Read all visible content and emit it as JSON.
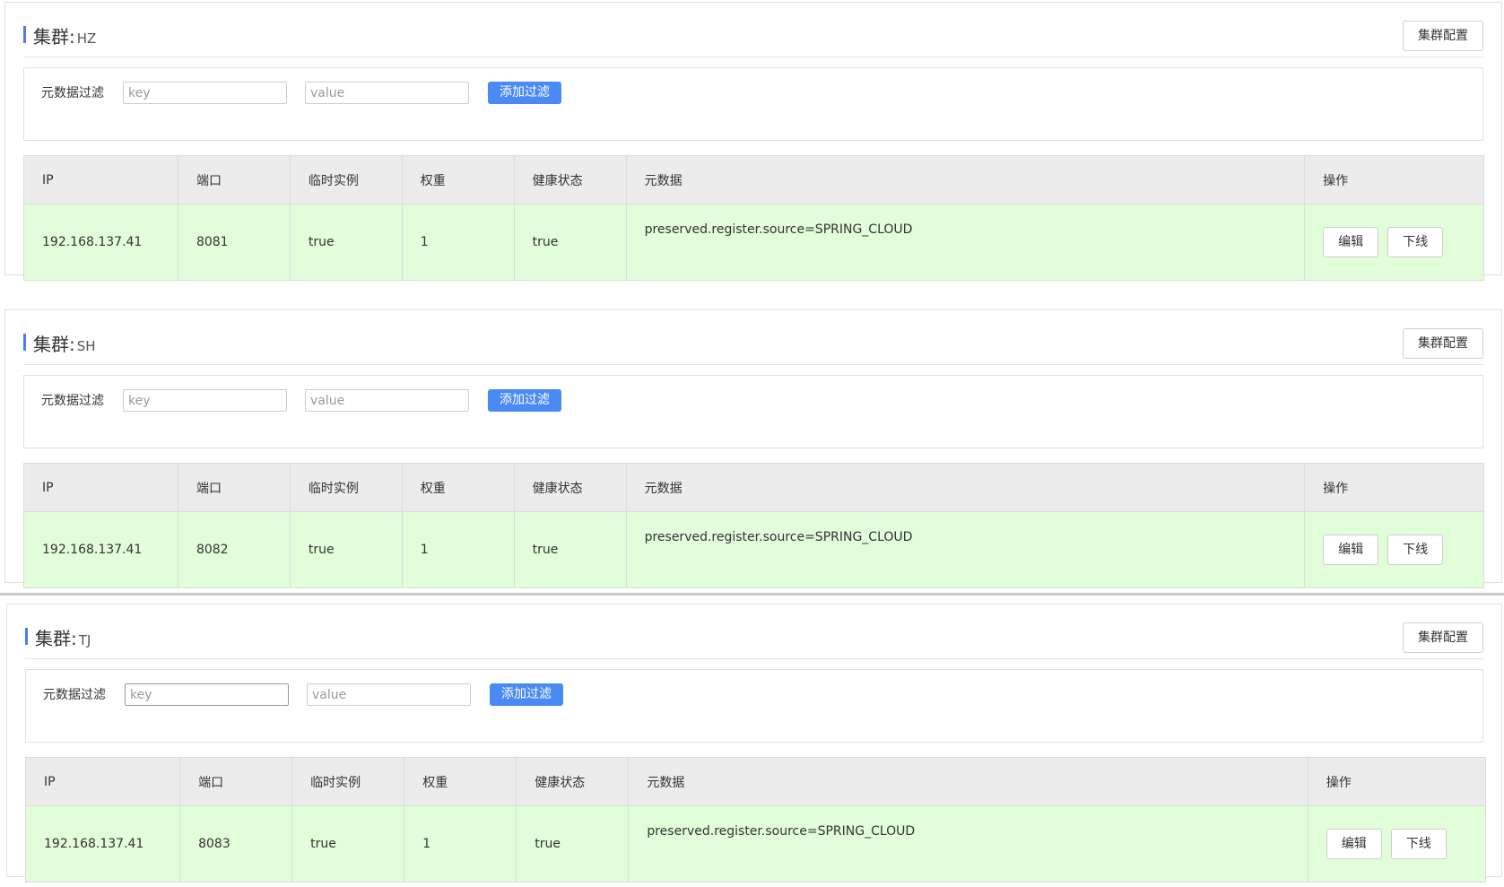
{
  "filter_label": "元数据过滤",
  "key_placeholder": "key",
  "value_placeholder": "value",
  "add_filter_label": "添加过滤",
  "cluster_title_prefix": "集群:",
  "cluster_config_label": "集群配置",
  "table_headers": [
    "IP",
    "端口",
    "临时实例",
    "权重",
    "健康状态",
    "元数据",
    "操作"
  ],
  "edit_label": "编辑",
  "offline_label": "下线",
  "colors": {
    "accent": "#4a7cf6",
    "add_filter_bg": "#4a8af4",
    "row_bg": "#e2fdd9",
    "header_bg": "#ececec"
  },
  "clusters": [
    {
      "name": "HZ",
      "instances": [
        {
          "ip": "192.168.137.41",
          "port": "8081",
          "ephemeral": "true",
          "weight": "1",
          "healthy": "true",
          "metadata": "preserved.register.source=SPRING_CLOUD"
        }
      ]
    },
    {
      "name": "SH",
      "instances": [
        {
          "ip": "192.168.137.41",
          "port": "8082",
          "ephemeral": "true",
          "weight": "1",
          "healthy": "true",
          "metadata": "preserved.register.source=SPRING_CLOUD"
        }
      ]
    },
    {
      "name": "TJ",
      "instances": [
        {
          "ip": "192.168.137.41",
          "port": "8083",
          "ephemeral": "true",
          "weight": "1",
          "healthy": "true",
          "metadata": "preserved.register.source=SPRING_CLOUD"
        }
      ]
    }
  ]
}
